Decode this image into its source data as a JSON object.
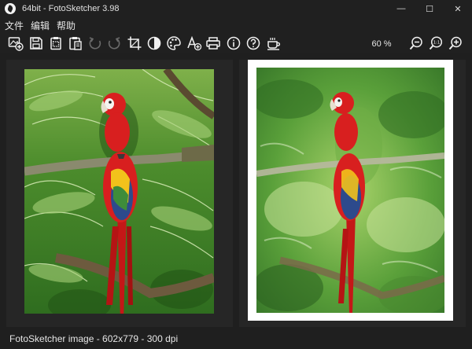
{
  "window": {
    "title": "64bit - FotoSketcher 3.98",
    "controls": {
      "minimize": "—",
      "maximize": "☐",
      "close": "✕"
    }
  },
  "menu": [
    {
      "label": "文件"
    },
    {
      "label": "编辑"
    },
    {
      "label": "帮助"
    }
  ],
  "toolbar": {
    "icons": [
      "open-image-icon",
      "save-icon",
      "copy-icon",
      "paste-icon",
      "undo-icon",
      "redo-icon",
      "crop-icon",
      "contrast-icon",
      "palette-icon",
      "add-text-icon",
      "print-icon",
      "info-icon",
      "help-icon",
      "coffee-icon",
      "zoom-out-icon",
      "zoom-actual-icon",
      "zoom-in-icon"
    ],
    "zoom_level": "60 %",
    "zoom_actual_label": "1:1"
  },
  "status": {
    "text": "FotoSketcher image - 602x779 - 300 dpi"
  },
  "colors": {
    "background": "#1f1f1f",
    "panel": "#262626",
    "parrot_red": "#d81f1f",
    "parrot_blue": "#2d4a8c",
    "foliage": "#3d8a2a"
  }
}
